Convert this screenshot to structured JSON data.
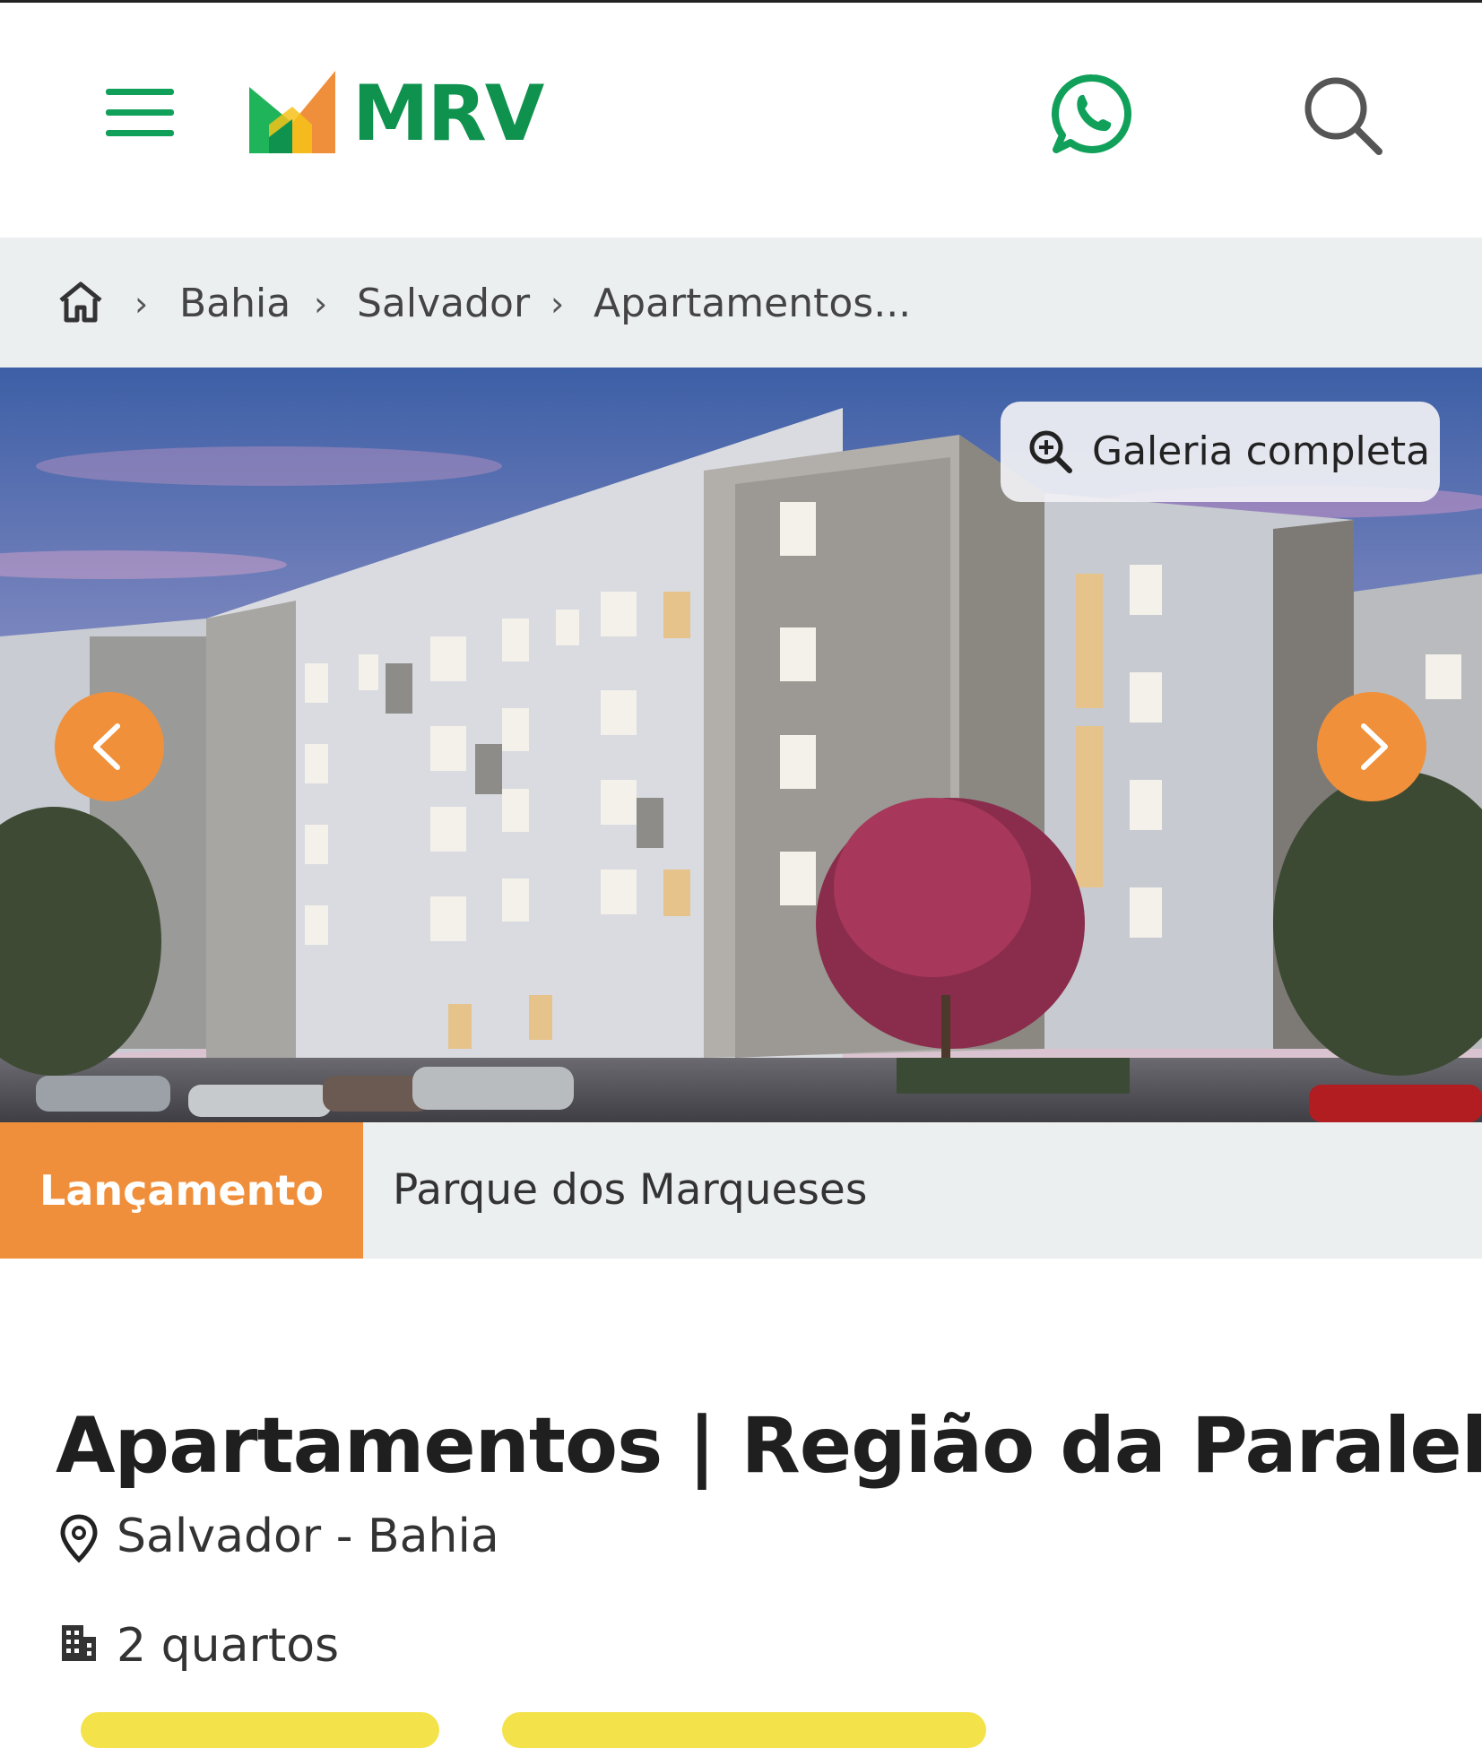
{
  "header": {
    "logo_text": "MRV",
    "brand_colors": {
      "green": "#10924f",
      "orange": "#f08f3b",
      "yellow": "#f6c21a"
    },
    "icons": [
      "menu-icon",
      "whatsapp-icon",
      "search-icon"
    ]
  },
  "breadcrumb": {
    "items": [
      "Bahia",
      "Salvador",
      "Apartamentos..."
    ],
    "separator": "›"
  },
  "gallery": {
    "button_label": "Galeria completa"
  },
  "listing": {
    "status_badge": "Lançamento",
    "development_name": "Parque dos Marqueses",
    "title": "Apartamentos | Região da Paralela",
    "location": "Salvador - Bahia",
    "rooms": "2 quartos"
  }
}
